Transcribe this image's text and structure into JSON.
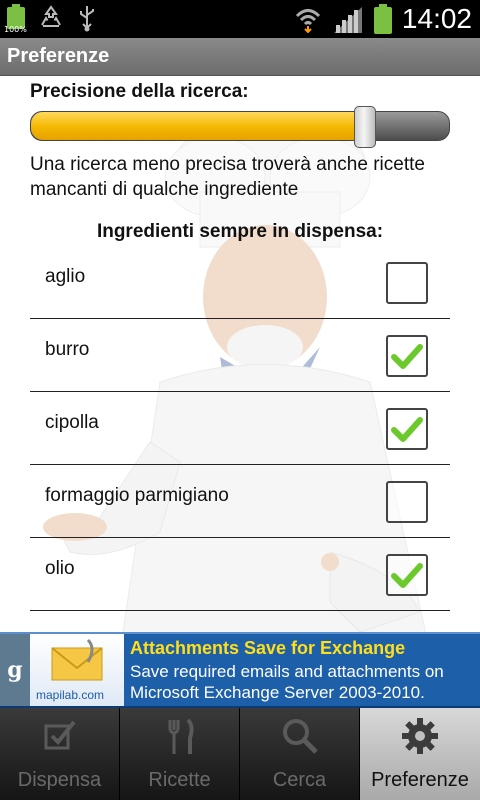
{
  "status_bar": {
    "battery_small_label": "100%",
    "time": "14:02"
  },
  "title_bar": {
    "title": "Preferenze"
  },
  "preferences": {
    "precision_label": "Precisione della ricerca:",
    "precision_value": 0.8,
    "precision_description": "Una ricerca meno precisa troverà anche ricette mancanti di qualche ingrediente",
    "pantry_label": "Ingredienti sempre in dispensa:",
    "ingredients": [
      {
        "name": "aglio",
        "checked": false
      },
      {
        "name": "burro",
        "checked": true
      },
      {
        "name": "cipolla",
        "checked": true
      },
      {
        "name": "formaggio parmigiano",
        "checked": false
      },
      {
        "name": "olio",
        "checked": true
      }
    ]
  },
  "ad": {
    "badge": "g",
    "logo_text": "mapilab.com",
    "headline": "Attachments Save for Exchange",
    "line1": "Save required emails and attachments on",
    "line2": "Microsoft Exchange Server 2003-2010."
  },
  "tabs": [
    {
      "label": "Dispensa",
      "icon": "checkbox-icon",
      "active": false
    },
    {
      "label": "Ricette",
      "icon": "cutlery-icon",
      "active": false
    },
    {
      "label": "Cerca",
      "icon": "magnifier-icon",
      "active": false
    },
    {
      "label": "Preferenze",
      "icon": "gear-icon",
      "active": true
    }
  ],
  "colors": {
    "slider_fill": "#f3b700",
    "check_green": "#6cc92c",
    "ad_blue": "#1d5fa9",
    "ad_headline": "#ffde1a"
  }
}
